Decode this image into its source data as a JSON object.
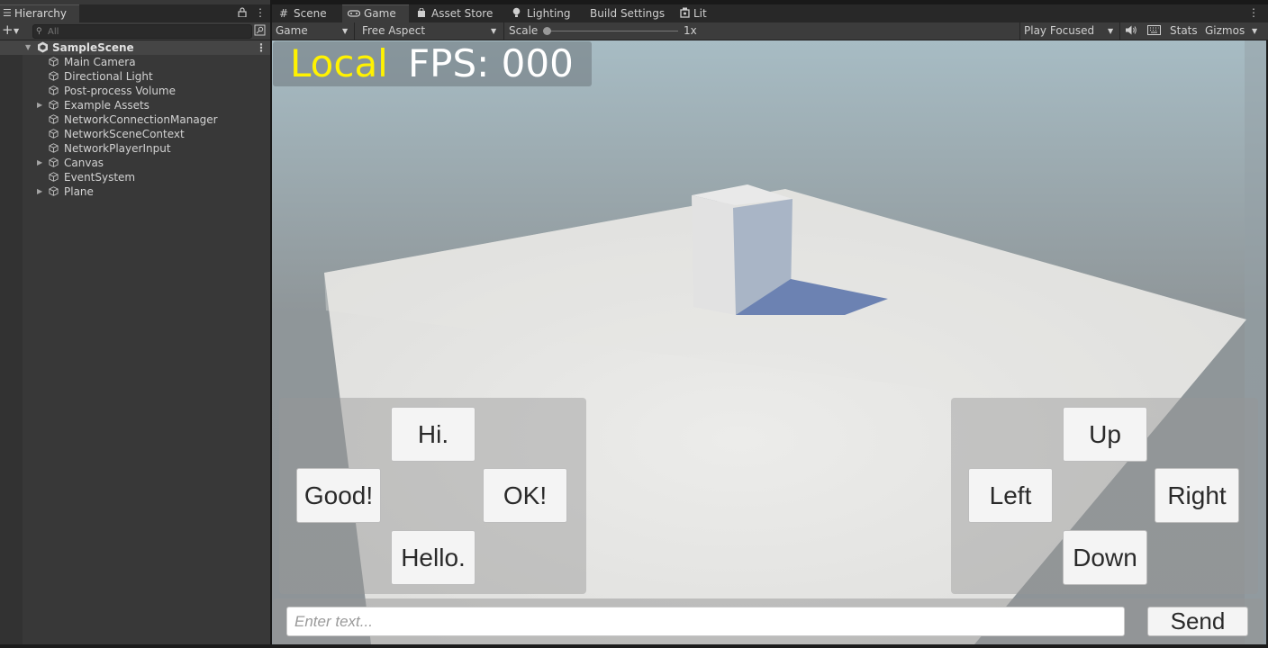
{
  "hierarchy": {
    "tab_label": "Hierarchy",
    "search_placeholder": "All",
    "scene_name": "SampleScene",
    "items": [
      {
        "label": "Main Camera",
        "expandable": false
      },
      {
        "label": "Directional Light",
        "expandable": false
      },
      {
        "label": "Post-process Volume",
        "expandable": false
      },
      {
        "label": "Example Assets",
        "expandable": true
      },
      {
        "label": "NetworkConnectionManager",
        "expandable": false
      },
      {
        "label": "NetworkSceneContext",
        "expandable": false
      },
      {
        "label": "NetworkPlayerInput",
        "expandable": false
      },
      {
        "label": "Canvas",
        "expandable": true
      },
      {
        "label": "EventSystem",
        "expandable": false
      },
      {
        "label": "Plane",
        "expandable": true
      }
    ]
  },
  "tabs": {
    "scene": "Scene",
    "game": "Game",
    "asset_store": "Asset Store",
    "lighting": "Lighting",
    "build_settings": "Build Settings",
    "lit": "Lit"
  },
  "game_toolbar": {
    "display": "Game",
    "aspect": "Free Aspect",
    "scale_label": "Scale",
    "scale_value": "1x",
    "play_mode": "Play Focused",
    "stats": "Stats",
    "gizmos": "Gizmos"
  },
  "game_ui": {
    "local_label": "Local",
    "fps_label": "FPS: 000",
    "chat_buttons": {
      "hi": "Hi.",
      "good": "Good!",
      "ok": "OK!",
      "hello": "Hello."
    },
    "move_buttons": {
      "up": "Up",
      "left": "Left",
      "right": "Right",
      "down": "Down"
    },
    "chat_placeholder": "Enter text...",
    "send_label": "Send"
  },
  "colors": {
    "local_text": "#fff200",
    "editor_bg": "#383838",
    "panel_bg": "#3c3c3c"
  }
}
